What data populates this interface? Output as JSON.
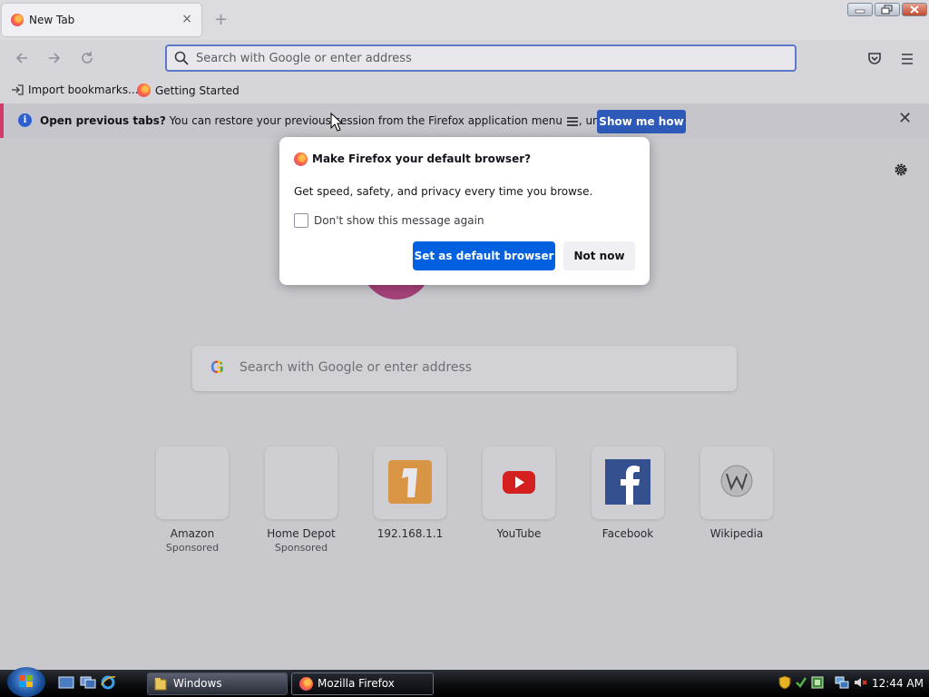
{
  "browser": {
    "tab_title": "New Tab",
    "tab_close": "×",
    "new_tab": "+",
    "url_placeholder": "Search with Google or enter address"
  },
  "bookmarks": [
    {
      "label": "Import bookmarks...",
      "icon": "import-icon"
    },
    {
      "label": "Getting Started",
      "icon": "firefox-icon"
    }
  ],
  "notification": {
    "bold": "Open previous tabs?",
    "text_before": " You can restore your previous session from the Firefox application menu ",
    "text_after": ", under History.",
    "button": "Show me how",
    "close": "✕"
  },
  "dialog": {
    "title": "Make Firefox your default browser?",
    "body": "Get speed, safety, and privacy every time you browse.",
    "checkbox_label": "Don't show this message again",
    "primary_button": "Set as default browser",
    "secondary_button": "Not now"
  },
  "newtab": {
    "search_placeholder": "Search with Google or enter address",
    "google_letter": "G",
    "top_sites": [
      {
        "label": "Amazon",
        "sponsored": "Sponsored",
        "icon": ""
      },
      {
        "label": "Home Depot",
        "sponsored": "Sponsored",
        "icon": ""
      },
      {
        "label": "192.168.1.1",
        "sponsored": "",
        "icon": "router-icon"
      },
      {
        "label": "YouTube",
        "sponsored": "",
        "icon": "youtube-icon"
      },
      {
        "label": "Facebook",
        "sponsored": "",
        "icon": "facebook-icon"
      },
      {
        "label": "Wikipedia",
        "sponsored": "",
        "icon": "wikipedia-icon"
      }
    ]
  },
  "taskbar": {
    "buttons": [
      {
        "label": "Windows",
        "icon": "folder-icon"
      },
      {
        "label": "Mozilla Firefox",
        "icon": "firefox-icon"
      }
    ],
    "clock": "12:44 AM"
  },
  "colors": {
    "accent": "#0061e0",
    "notification_accent": "#d33a6a"
  }
}
